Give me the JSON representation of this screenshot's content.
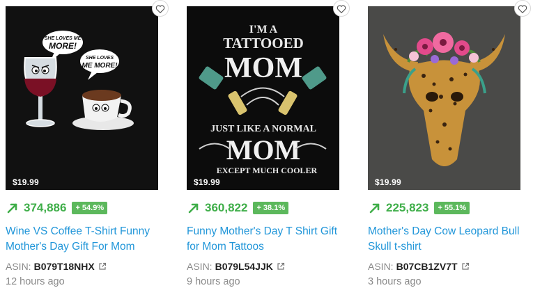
{
  "colors": {
    "accent_green": "#3fae49",
    "badge_green": "#5cb85c",
    "link_blue": "#2196d9",
    "muted_gray": "#8a8a8a"
  },
  "asin_label": "ASIN:",
  "products": [
    {
      "image_text": {
        "bubble1": [
          "SHE LOVES ME",
          "MORE!"
        ],
        "bubble2": [
          "SHE LOVES",
          "ME MORE!"
        ]
      },
      "price": "$19.99",
      "rank": "374,886",
      "change": "+ 54.9%",
      "title": "Wine VS Coffee T-Shirt Funny Mother's Day Gift For Mom",
      "asin": "B079T18NHX",
      "time_ago": "12 hours ago"
    },
    {
      "image_text": {
        "line1": "I'M A",
        "line2": "TATTOOED",
        "line3": "MOM",
        "line4": "JUST LIKE A NORMAL",
        "line5": "MOM",
        "line6": "EXCEPT MUCH COOLER"
      },
      "price": "$19.99",
      "rank": "360,822",
      "change": "+ 38.1%",
      "title": "Funny Mother's Day T Shirt Gift for Mom Tattoos",
      "asin": "B079L54JJK",
      "time_ago": "9 hours ago"
    },
    {
      "price": "$19.99",
      "rank": "225,823",
      "change": "+ 55.1%",
      "title": "Mother's Day Cow Leopard Bull Skull t-shirt",
      "asin": "B07CB1ZV7T",
      "time_ago": "3 hours ago"
    }
  ],
  "icons": {
    "favorite": "heart-icon",
    "trend": "trending-up-icon",
    "external": "external-link-icon"
  }
}
